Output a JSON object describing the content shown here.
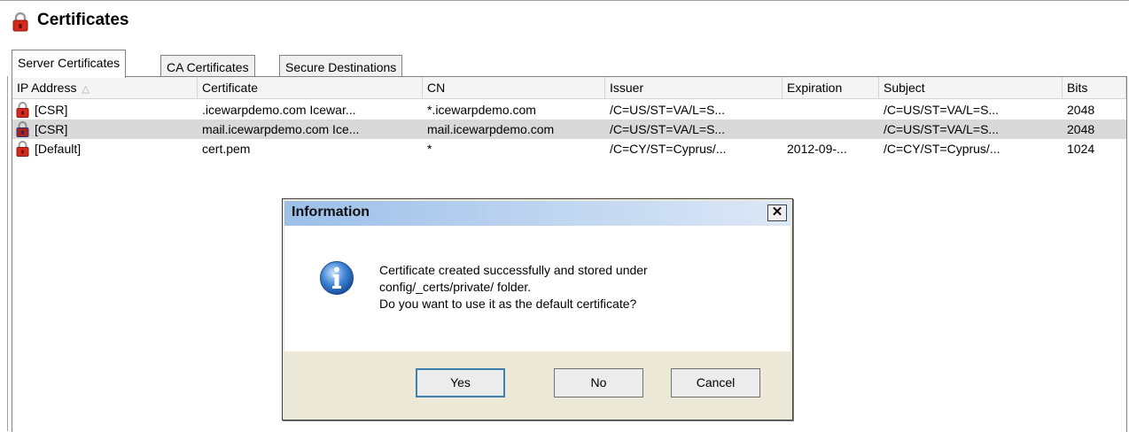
{
  "panel": {
    "title": "Certificates"
  },
  "tabs": [
    {
      "label": "Server Certificates",
      "active": true
    },
    {
      "label": "CA Certificates",
      "active": false
    },
    {
      "label": "Secure Destinations",
      "active": false
    }
  ],
  "table": {
    "columns": [
      "IP Address",
      "Certificate",
      "CN",
      "Issuer",
      "Expiration",
      "Subject",
      "Bits"
    ],
    "sort_indicator": "△",
    "rows": [
      {
        "ip": "[CSR]",
        "certificate": ".icewarpdemo.com Icewar...",
        "cn": "*.icewarpdemo.com",
        "issuer": "/C=US/ST=VA/L=S...",
        "expiration": "",
        "subject": "/C=US/ST=VA/L=S...",
        "bits": "2048",
        "selected": false
      },
      {
        "ip": "[CSR]",
        "certificate": "mail.icewarpdemo.com Ice...",
        "cn": "mail.icewarpdemo.com",
        "issuer": "/C=US/ST=VA/L=S...",
        "expiration": "",
        "subject": "/C=US/ST=VA/L=S...",
        "bits": "2048",
        "selected": true
      },
      {
        "ip": "[Default]",
        "certificate": "cert.pem",
        "cn": "*",
        "issuer": "/C=CY/ST=Cyprus/...",
        "expiration": "2012-09-...",
        "subject": "/C=CY/ST=Cyprus/...",
        "bits": "1024",
        "selected": false
      }
    ]
  },
  "dialog": {
    "title": "Information",
    "close_glyph": "✕",
    "message_lines": [
      "Certificate created successfully and stored under",
      "config/_certs/private/ folder.",
      "Do you want to use it as the default certificate?"
    ],
    "buttons": {
      "yes": "Yes",
      "no": "No",
      "cancel": "Cancel"
    }
  },
  "icons": {
    "header": "padlock-icon",
    "row": "padlock-icon",
    "dialog": "info-icon"
  },
  "colors": {
    "titlebar_start": "#9cbfe9",
    "selection": "#d9d9d9",
    "lock_red": "#d42a1c",
    "info_blue": "#2d6fc4"
  }
}
